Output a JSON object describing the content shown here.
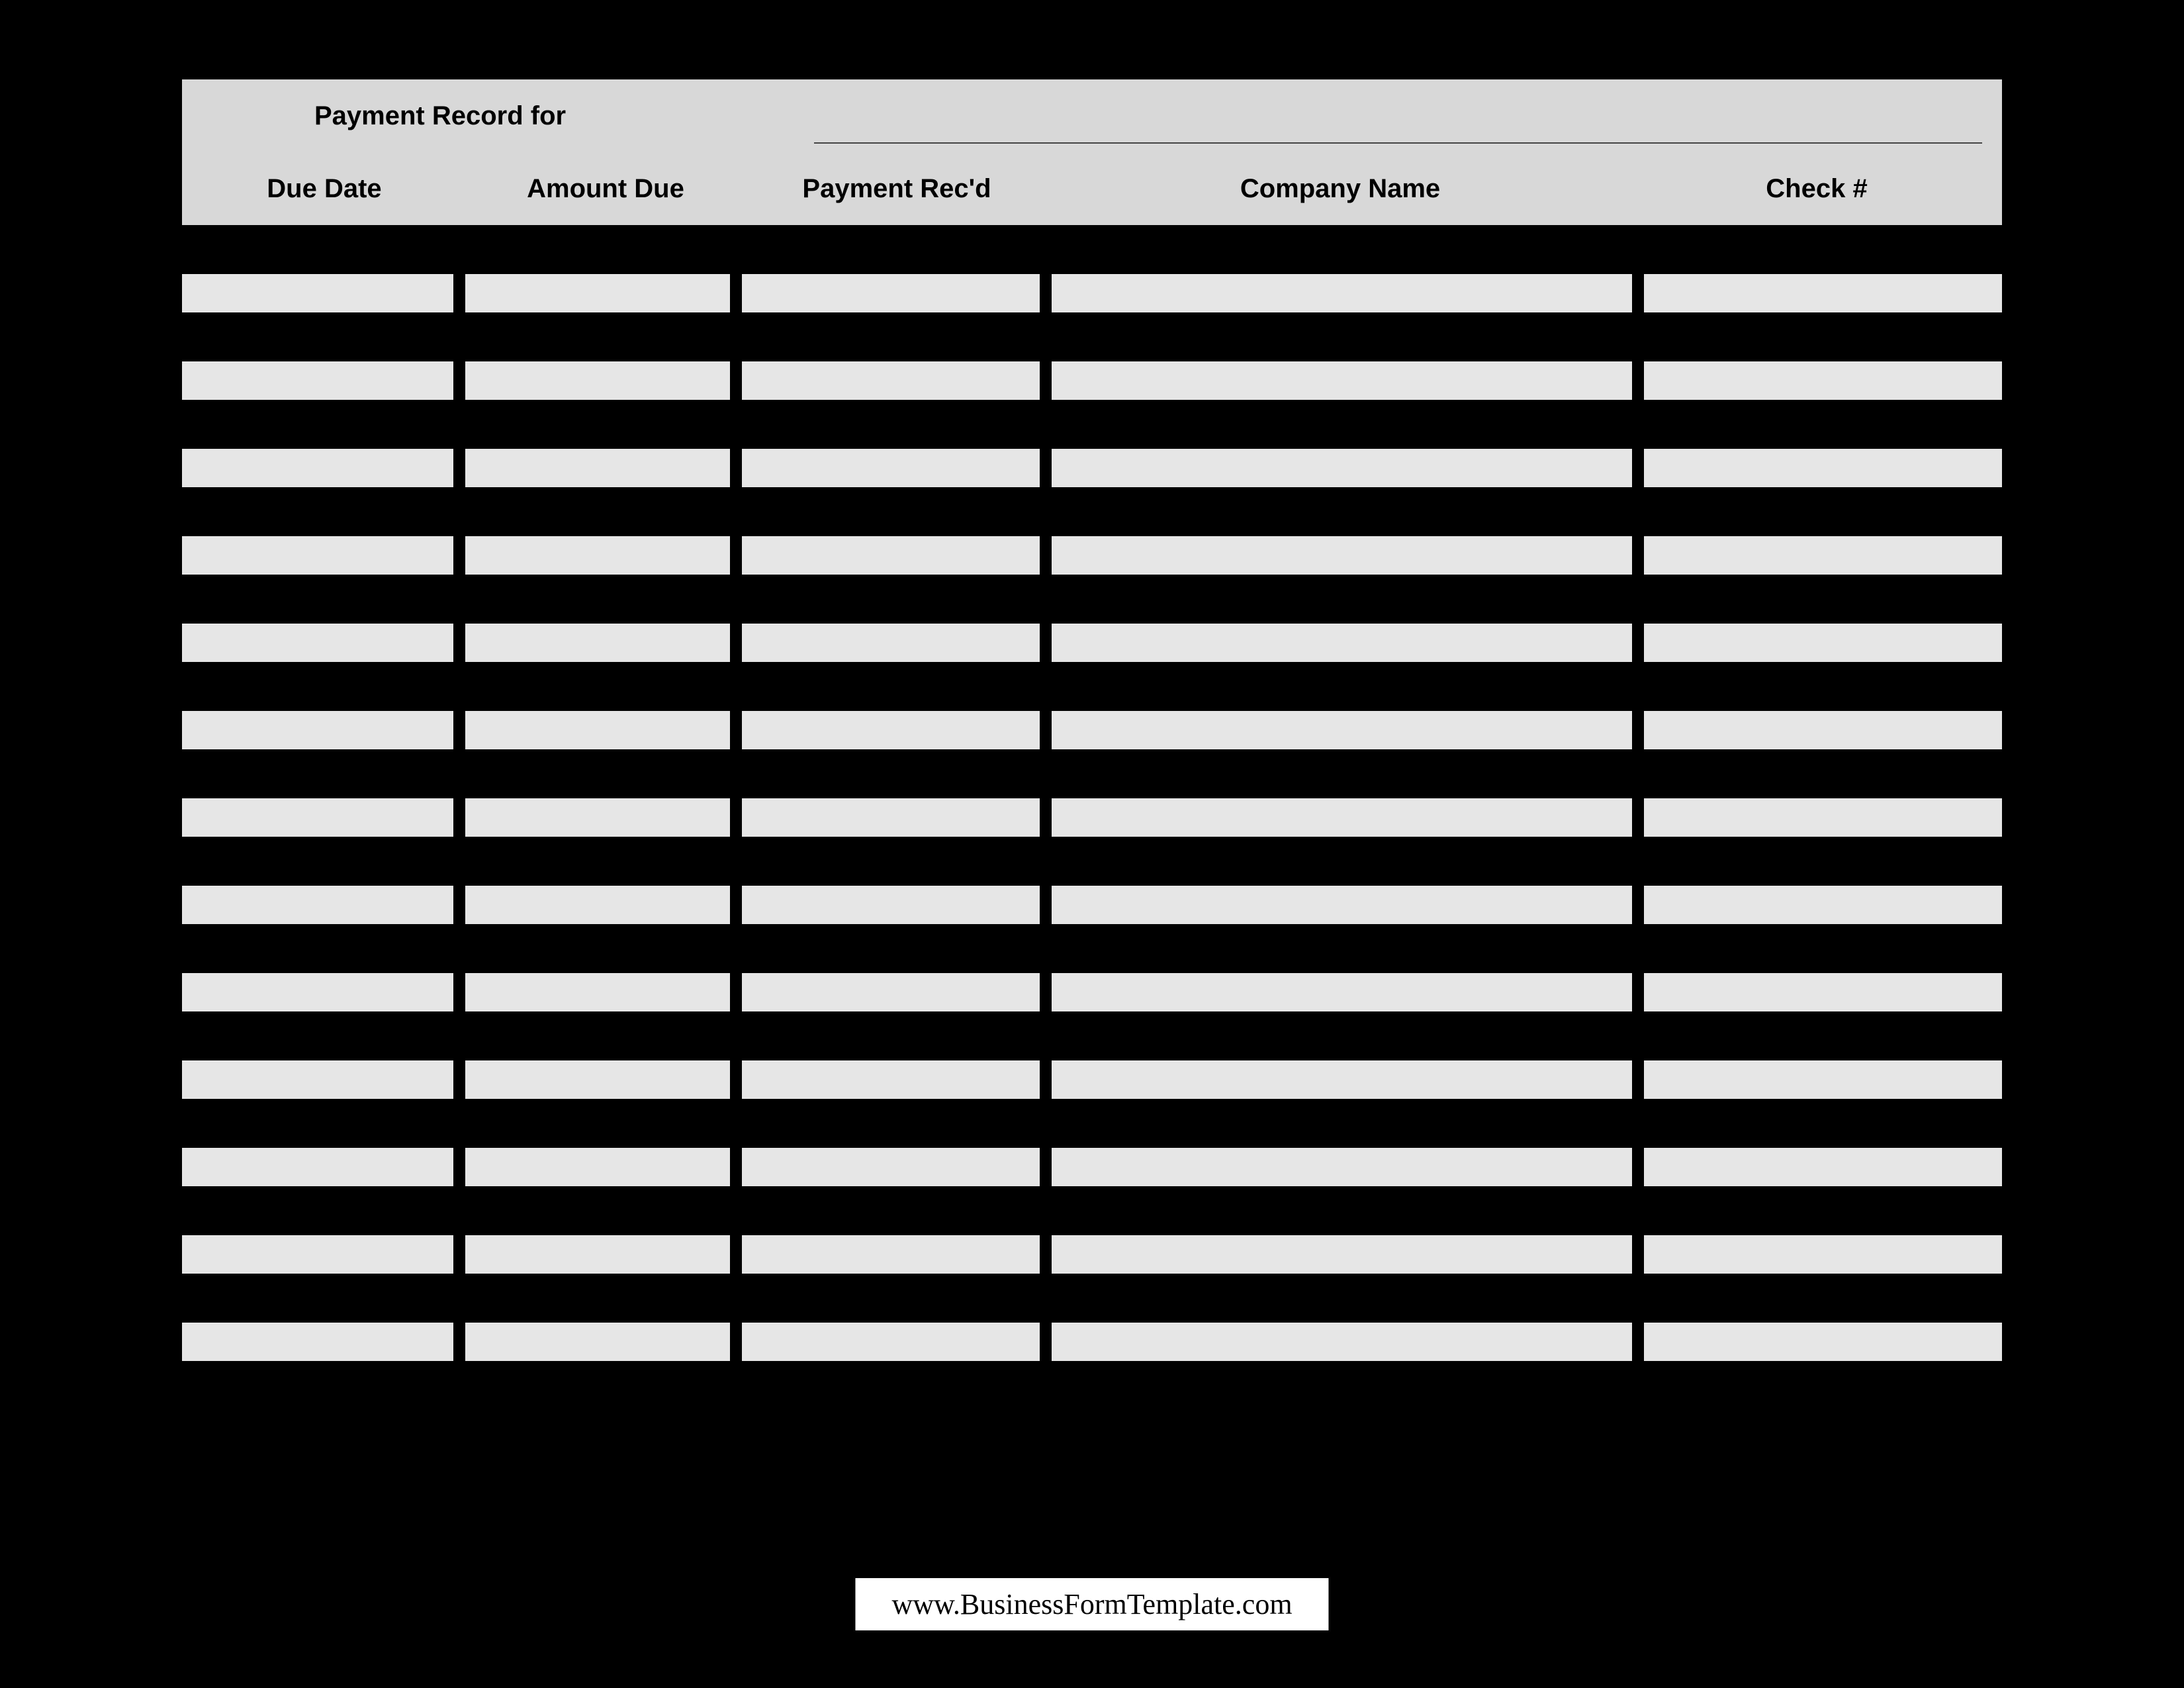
{
  "header": {
    "title_label": "Payment Record for",
    "for_value": ""
  },
  "columns": {
    "due_date": "Due Date",
    "amount_due": "Amount Due",
    "payment_recd": "Payment Rec'd",
    "company_name": "Company Name",
    "check_no": "Check #"
  },
  "rows": [
    {
      "due_date": "",
      "amount_due": "",
      "payment_recd": "",
      "company_name": "",
      "check_no": ""
    },
    {
      "due_date": "",
      "amount_due": "",
      "payment_recd": "",
      "company_name": "",
      "check_no": ""
    },
    {
      "due_date": "",
      "amount_due": "",
      "payment_recd": "",
      "company_name": "",
      "check_no": ""
    },
    {
      "due_date": "",
      "amount_due": "",
      "payment_recd": "",
      "company_name": "",
      "check_no": ""
    },
    {
      "due_date": "",
      "amount_due": "",
      "payment_recd": "",
      "company_name": "",
      "check_no": ""
    },
    {
      "due_date": "",
      "amount_due": "",
      "payment_recd": "",
      "company_name": "",
      "check_no": ""
    },
    {
      "due_date": "",
      "amount_due": "",
      "payment_recd": "",
      "company_name": "",
      "check_no": ""
    },
    {
      "due_date": "",
      "amount_due": "",
      "payment_recd": "",
      "company_name": "",
      "check_no": ""
    },
    {
      "due_date": "",
      "amount_due": "",
      "payment_recd": "",
      "company_name": "",
      "check_no": ""
    },
    {
      "due_date": "",
      "amount_due": "",
      "payment_recd": "",
      "company_name": "",
      "check_no": ""
    },
    {
      "due_date": "",
      "amount_due": "",
      "payment_recd": "",
      "company_name": "",
      "check_no": ""
    },
    {
      "due_date": "",
      "amount_due": "",
      "payment_recd": "",
      "company_name": "",
      "check_no": ""
    },
    {
      "due_date": "",
      "amount_due": "",
      "payment_recd": "",
      "company_name": "",
      "check_no": ""
    }
  ],
  "footer": {
    "attribution": "www.BusinessFormTemplate.com"
  }
}
